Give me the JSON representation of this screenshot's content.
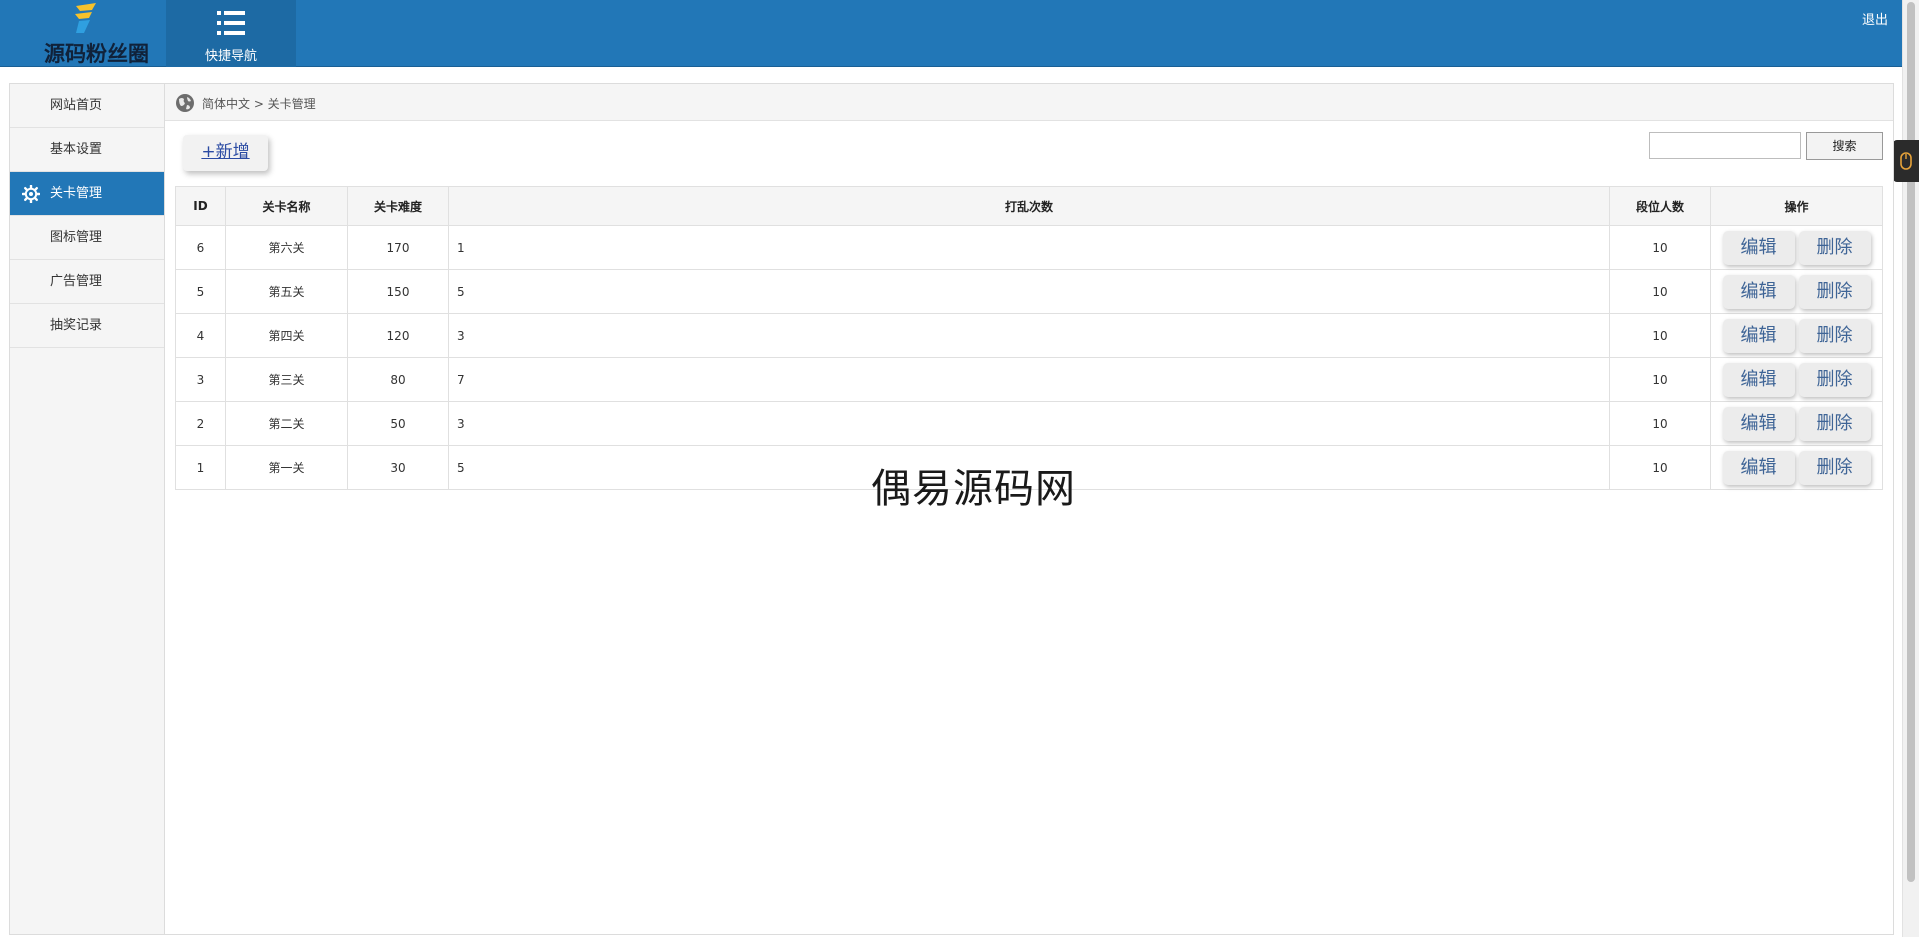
{
  "header": {
    "logo_text": "源码粉丝圈",
    "quick_nav_label": "快捷导航",
    "logout_label": "退出"
  },
  "sidebar": {
    "items": [
      {
        "label": "网站首页"
      },
      {
        "label": "基本设置"
      },
      {
        "label": "关卡管理"
      },
      {
        "label": "图标管理"
      },
      {
        "label": "广告管理"
      },
      {
        "label": "抽奖记录"
      }
    ],
    "active_index": 2
  },
  "breadcrumb": {
    "text": "简体中文 > 关卡管理"
  },
  "toolbar": {
    "add_label": "+新增",
    "search_value": "",
    "search_button": "搜索"
  },
  "table": {
    "headers": [
      "ID",
      "关卡名称",
      "关卡难度",
      "打乱次数",
      "段位人数",
      "操作"
    ],
    "rows": [
      {
        "id": "6",
        "name": "第六关",
        "difficulty": "170",
        "shuffles": "1",
        "rank_count": "10"
      },
      {
        "id": "5",
        "name": "第五关",
        "difficulty": "150",
        "shuffles": "5",
        "rank_count": "10"
      },
      {
        "id": "4",
        "name": "第四关",
        "difficulty": "120",
        "shuffles": "3",
        "rank_count": "10"
      },
      {
        "id": "3",
        "name": "第三关",
        "difficulty": "80",
        "shuffles": "7",
        "rank_count": "10"
      },
      {
        "id": "2",
        "name": "第二关",
        "difficulty": "50",
        "shuffles": "3",
        "rank_count": "10"
      },
      {
        "id": "1",
        "name": "第一关",
        "difficulty": "30",
        "shuffles": "5",
        "rank_count": "10"
      }
    ],
    "edit_label": "编辑",
    "delete_label": "删除"
  },
  "watermark": "偶易源码网",
  "colors": {
    "header_bg": "#2277b7",
    "active_item_bg": "#2277b7",
    "button_text": "#3e6496"
  },
  "icons": {
    "quick_nav": "list-icon",
    "active_item": "gear-icon",
    "breadcrumb": "globe-icon"
  }
}
